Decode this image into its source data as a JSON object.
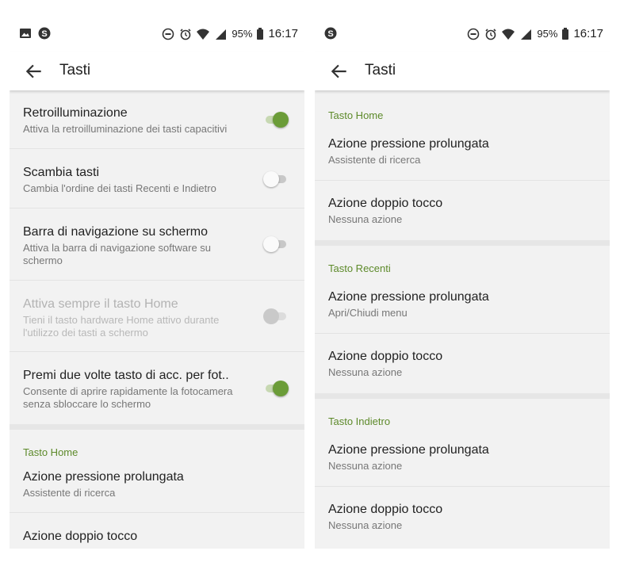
{
  "status": {
    "battery": "95%",
    "time": "16:17"
  },
  "left": {
    "title": "Tasti",
    "rows": [
      {
        "title": "Retroilluminazione",
        "subtitle": "Attiva la retroilluminazione dei tasti capacitivi",
        "toggle": "on"
      },
      {
        "title": "Scambia tasti",
        "subtitle": "Cambia l'ordine dei tasti Recenti e Indietro",
        "toggle": "off"
      },
      {
        "title": "Barra di navigazione su schermo",
        "subtitle": "Attiva la barra di navigazione software su schermo",
        "toggle": "off"
      },
      {
        "title": "Attiva sempre il tasto Home",
        "subtitle": "Tieni il tasto hardware Home attivo durante l'utilizzo dei tasti a schermo",
        "toggle": "disabled"
      },
      {
        "title": "Premi due volte tasto di acc. per fot..",
        "subtitle": "Consente di aprire rapidamente la fotocamera senza sbloccare lo schermo",
        "toggle": "on"
      }
    ],
    "section": {
      "header": "Tasto Home",
      "items": [
        {
          "title": "Azione pressione prolungata",
          "subtitle": "Assistente di ricerca"
        },
        {
          "title": "Azione doppio tocco",
          "subtitle": ""
        }
      ]
    }
  },
  "right": {
    "title": "Tasti",
    "sections": [
      {
        "header": "Tasto Home",
        "items": [
          {
            "title": "Azione pressione prolungata",
            "subtitle": "Assistente di ricerca"
          },
          {
            "title": "Azione doppio tocco",
            "subtitle": "Nessuna azione"
          }
        ]
      },
      {
        "header": "Tasto Recenti",
        "items": [
          {
            "title": "Azione pressione prolungata",
            "subtitle": "Apri/Chiudi menu"
          },
          {
            "title": "Azione doppio tocco",
            "subtitle": "Nessuna azione"
          }
        ]
      },
      {
        "header": "Tasto Indietro",
        "items": [
          {
            "title": "Azione pressione prolungata",
            "subtitle": "Nessuna azione"
          },
          {
            "title": "Azione doppio tocco",
            "subtitle": "Nessuna azione"
          }
        ]
      }
    ]
  },
  "colors": {
    "accent": "#6b9c38",
    "section_header": "#5d8a2a",
    "background": "#f2f2f2"
  }
}
